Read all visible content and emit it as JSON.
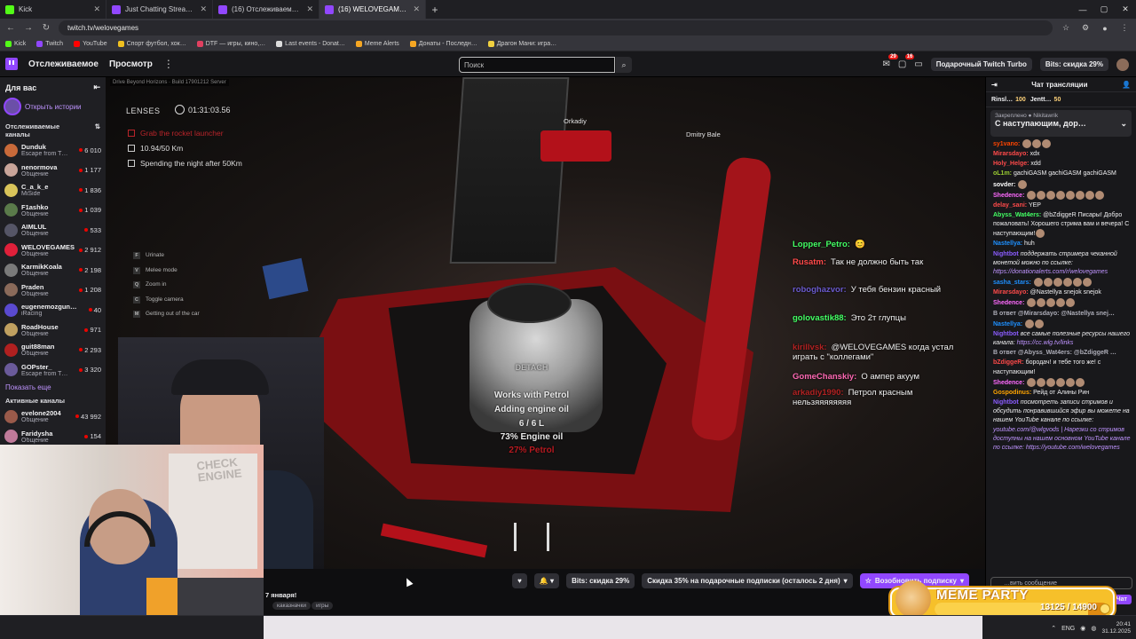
{
  "browser": {
    "tabs": [
      {
        "title": "Kick",
        "color": "#53fc18",
        "active": false
      },
      {
        "title": "Just Chatting Streaming - Live",
        "color": "#9147ff",
        "active": false
      },
      {
        "title": "(16) Отслеживаемые активн…",
        "color": "#9147ff",
        "active": false
      },
      {
        "title": "(16) WELOVEGAMES - Twit…",
        "color": "#9147ff",
        "active": true
      }
    ],
    "new_tab": "+",
    "url": "twitch.tv/welovegames",
    "bookmarks": [
      {
        "label": "Kick",
        "color": "#53fc18"
      },
      {
        "label": "Twitch",
        "color": "#9147ff"
      },
      {
        "label": "YouTube",
        "color": "#ff0000"
      },
      {
        "label": "Спорт футбол, хок…",
        "color": "#f0c020"
      },
      {
        "label": "DTF — игры, кино,…",
        "color": "#e04060"
      },
      {
        "label": "Last events - Donat…",
        "color": "#dddddd"
      },
      {
        "label": "Meme Alerts",
        "color": "#f5a623"
      },
      {
        "label": "Донаты - Последн…",
        "color": "#f5a623"
      },
      {
        "label": "Драгон Мани: игра…",
        "color": "#f0d040"
      }
    ]
  },
  "topnav": {
    "following": "Отслеживаемое",
    "browse": "Просмотр",
    "more": "⋮",
    "search_placeholder": "Поиск",
    "notif_count_1": "29",
    "notif_count_2": "16",
    "turbo": "Подарочный Twitch Turbo",
    "bits": "Bits: скидка 29%"
  },
  "sidebar": {
    "for_you": "Для вас",
    "open_history": "Открыть истории",
    "followed_title": "Отслеживаемые каналы",
    "channels": [
      {
        "name": "Dunduk",
        "game": "Escape from T…",
        "viewers": "6 010",
        "color": "#c96a3a"
      },
      {
        "name": "nenormova",
        "game": "Общение",
        "viewers": "1 177",
        "color": "#c9a59a"
      },
      {
        "name": "C_a_k_e",
        "game": "MiSide",
        "viewers": "1 836",
        "color": "#d9c45a"
      },
      {
        "name": "F1ashko",
        "game": "Общение",
        "viewers": "1 039",
        "color": "#5a7a4a"
      },
      {
        "name": "AIMLUL",
        "game": "Общение",
        "viewers": "533",
        "color": "#555566"
      },
      {
        "name": "WELOVEGAMES",
        "game": "Общение",
        "viewers": "2 912",
        "color": "#e0203a"
      },
      {
        "name": "KarmikKoala",
        "game": "Общение",
        "viewers": "2 198",
        "color": "#7a7a7a"
      },
      {
        "name": "Praden",
        "game": "Общение",
        "viewers": "1 208",
        "color": "#8a6a5a"
      },
      {
        "name": "eugenemozgun…",
        "game": "iRacing",
        "viewers": "40",
        "color": "#5a4ad0"
      },
      {
        "name": "RoadHouse",
        "game": "Общение",
        "viewers": "971",
        "color": "#c0a060"
      },
      {
        "name": "guit88man",
        "game": "Общение",
        "viewers": "2 293",
        "color": "#b02020"
      },
      {
        "name": "GOPster_",
        "game": "Escape from T…",
        "viewers": "3 320",
        "color": "#6a5a9a"
      }
    ],
    "show_more": "Показать еще",
    "active_title": "Активные каналы",
    "active": [
      {
        "name": "evelone2004",
        "game": "Общение",
        "viewers": "43 992",
        "color": "#9a5a4a"
      },
      {
        "name": "Faridysha",
        "game": "Общение",
        "viewers": "154",
        "color": "#c07a9a"
      }
    ]
  },
  "video": {
    "build": "Drive Beyond Horizons · Build 17901212 Server",
    "lenses": "LENSES",
    "timer": "01:31:03.56",
    "objectives": [
      {
        "text": "Grab the rocket launcher",
        "done": true
      },
      {
        "text": "10.94/50 Km",
        "done": false
      },
      {
        "text": "Spending the night after 50Km",
        "done": false
      }
    ],
    "keys": [
      {
        "key": "F",
        "label": "Urinate"
      },
      {
        "key": "V",
        "label": "Melee mode"
      },
      {
        "key": "Q",
        "label": "Zoom in"
      },
      {
        "key": "C",
        "label": "Toggle camera"
      },
      {
        "key": "M",
        "label": "Getting out of the car"
      }
    ],
    "player1": "Orkadiy",
    "player2": "Dmitry Bale",
    "detach": "DETACH",
    "works_with": "Works with Petrol",
    "adding": "Adding engine oil",
    "amount": "6 / 6 L",
    "oil_pct": "73% Engine oil",
    "petrol_pct": "27% Petrol",
    "overlay_chat": [
      {
        "user": "Lopper_Petro:",
        "text": "😊",
        "color": "#43ff64"
      },
      {
        "user": "Rusatm:",
        "text": "Так не должно быть так",
        "color": "#ff4a4a"
      },
      {
        "user": "roboghazvor:",
        "text": "У тебя бензин красный",
        "color": "#6a5acd"
      },
      {
        "user": "golovastik88:",
        "text": "Это 2т глупцы",
        "color": "#43ff64"
      },
      {
        "user": "kirillvsk:",
        "text": "@WELOVEGAMES когда устал играть с \"коллегами\"",
        "color": "#b22222"
      },
      {
        "user": "GomeChanskiy:",
        "text": "О ампер акуум",
        "color": "#ff69b4"
      },
      {
        "user": "arkadiy1990:",
        "text": "Петрол красным нельзяяяяяяяя",
        "color": "#b22222"
      }
    ]
  },
  "cam": {
    "sticker": "CHECK ENGINE"
  },
  "below": {
    "title": "7 января!",
    "tags": [
      "каказначки",
      "игры"
    ],
    "bits_label": "Bits: скидка 29%",
    "discount_label": "Скидка 35% на подарочные подписки (осталось 2 дня)",
    "renew_label": "Возобновить подписку"
  },
  "chat": {
    "title": "Чат трансляции",
    "gifts": [
      {
        "name": "Rinsl…",
        "count": "100"
      },
      {
        "name": "Jentt…",
        "count": "50"
      }
    ],
    "pinned_by": "Закреплено ● Nikitawrik",
    "pinned_text": "С наступающим, дор…",
    "messages": [
      {
        "user": "sy1vano:",
        "color": "#ff4500",
        "text": "",
        "emotes": 3,
        "italic": false
      },
      {
        "user": "Mirarsdayo:",
        "color": "#ff4a4a",
        "text": "xdx",
        "emotes": 0,
        "italic": false
      },
      {
        "user": "Holy_Helge:",
        "color": "#ff4a4a",
        "text": "xdd",
        "emotes": 0,
        "italic": false
      },
      {
        "user": "oL1m:",
        "color": "#9acd32",
        "text": "gachiGASM gachiGASM gachiGASM",
        "emotes": 0,
        "italic": false
      },
      {
        "user": "sovder:",
        "color": "#ffffff",
        "text": "",
        "emotes": 1,
        "italic": false
      },
      {
        "user": "Shedence:",
        "color": "#ff6aff",
        "text": "",
        "emotes": 8,
        "italic": false
      },
      {
        "user": "delay_sani:",
        "color": "#ff4a4a",
        "text": "YEP",
        "emotes": 0,
        "italic": false
      },
      {
        "user": "Abyss_Wat4ers:",
        "color": "#43ff64",
        "text": "@bZdiggeR Писары! Добро пожаловать! Хорошего стрима вам и вечера! С наступающим!",
        "emotes": 1,
        "italic": false
      },
      {
        "user": "Nastellya:",
        "color": "#1e90ff",
        "text": "huh",
        "emotes": 0,
        "italic": false
      },
      {
        "user": "Nightbot",
        "color": "#8a5cff",
        "text": "поддержать стримера чеканной монетой можно по ссылке:",
        "link": "https://donationalerts.com/r/welovegames",
        "emotes": 0,
        "italic": true
      },
      {
        "user": "sasha_stars:",
        "color": "#1e90ff",
        "text": "",
        "emotes": 6,
        "italic": false
      },
      {
        "user": "Mirarsdayo:",
        "color": "#ff4a4a",
        "text": "@Nastellya snejok snejok",
        "emotes": 0,
        "italic": false
      },
      {
        "user": "Shedence:",
        "color": "#ff6aff",
        "text": "",
        "emotes": 5,
        "italic": false
      },
      {
        "user": "В ответ @Mirarsdayo: @Nastellya snej…",
        "color": "#adadb8",
        "text": "",
        "emotes": 0,
        "italic": false
      },
      {
        "user": "Nastellya:",
        "color": "#1e90ff",
        "text": "",
        "emotes": 2,
        "italic": false
      },
      {
        "user": "Nightbot",
        "color": "#8a5cff",
        "text": "все самые полезные ресурсы нашего канала:",
        "link": "https://cc.wlg.tv/links",
        "emotes": 0,
        "italic": true
      },
      {
        "user": "В ответ @Abyss_Wat4ers: @bZdiggeR …",
        "color": "#adadb8",
        "text": "",
        "emotes": 0,
        "italic": false
      },
      {
        "user": "bZdiggeR:",
        "color": "#ff4a4a",
        "text": "бородач! и тебе того же! с наступающим!",
        "emotes": 0,
        "italic": false
      },
      {
        "user": "Shedence:",
        "color": "#ff6aff",
        "text": "",
        "emotes": 6,
        "italic": false
      },
      {
        "user": "Gospodinus:",
        "color": "#ffa500",
        "text": "Рейд от Алины Рин",
        "emotes": 0,
        "italic": false
      },
      {
        "user": "Nightbot",
        "color": "#8a5cff",
        "text": "посмотреть записи стримов и обсудить понравившийся эфир вы можете на нашем YouTube канале по ссылке:",
        "link": "youtube.com/@wlgvods | Нарезки со стримов доступны на нашем основном YouTube канале по ссылке: https://youtube.com/welovegames",
        "emotes": 0,
        "italic": true
      }
    ],
    "input_placeholder": "…вить сообщение",
    "send": "Чат"
  },
  "meme_party": {
    "title": "MEME PARTY",
    "current": 13125,
    "goal": 14900,
    "label": "13125 / 14900"
  },
  "taskbar": {
    "lang": "ENG",
    "time": "20:41",
    "date": "31.12.2025"
  }
}
